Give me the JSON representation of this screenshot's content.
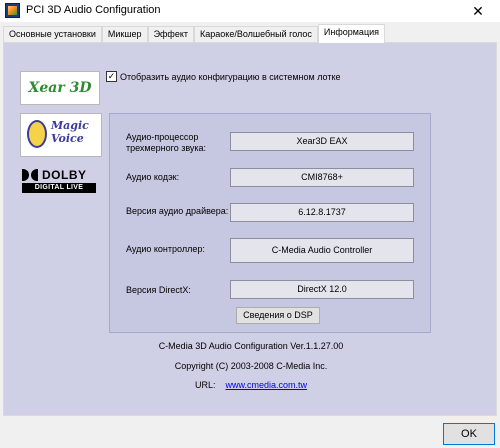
{
  "window": {
    "title": "PCI 3D Audio Configuration",
    "close_glyph": "✕"
  },
  "tabs": [
    {
      "label": "Основные установки"
    },
    {
      "label": "Микшер"
    },
    {
      "label": "Эффект"
    },
    {
      "label": "Караоке/Волшебный голос"
    },
    {
      "label": "Информация"
    }
  ],
  "logos": {
    "xear": "Xear 3D",
    "magic_voice_line1": "Magic",
    "magic_voice_line2": "Voice",
    "dolby": "DOLBY",
    "dolby_sub": "DIGITAL LIVE"
  },
  "systray_checkbox": {
    "label": "Отобразить аудио конфигурацию в системном лотке",
    "checked": true,
    "glyph": "✓"
  },
  "info": {
    "processor_label": "Аудио-процессор трехмерного звука:",
    "processor_value": "Xear3D  EAX",
    "codec_label": "Аудио кодэк:",
    "codec_value": "CMI8768+",
    "driver_label": "Версия аудио драйвера:",
    "driver_value": "6.12.8.1737",
    "controller_label": "Аудио контроллер:",
    "controller_value": "C-Media Audio Controller",
    "directx_label": "Версия DirectX:",
    "directx_value": "DirectX 12.0"
  },
  "dsp_button": "Сведения о DSP",
  "footer": {
    "version": "C-Media 3D Audio Configuration Ver.1.1.27.00",
    "copyright": "Copyright (C) 2003-2008 C-Media Inc.",
    "url_label": "URL:",
    "url": "www.cmedia.com.tw"
  },
  "ok_button": "OK"
}
